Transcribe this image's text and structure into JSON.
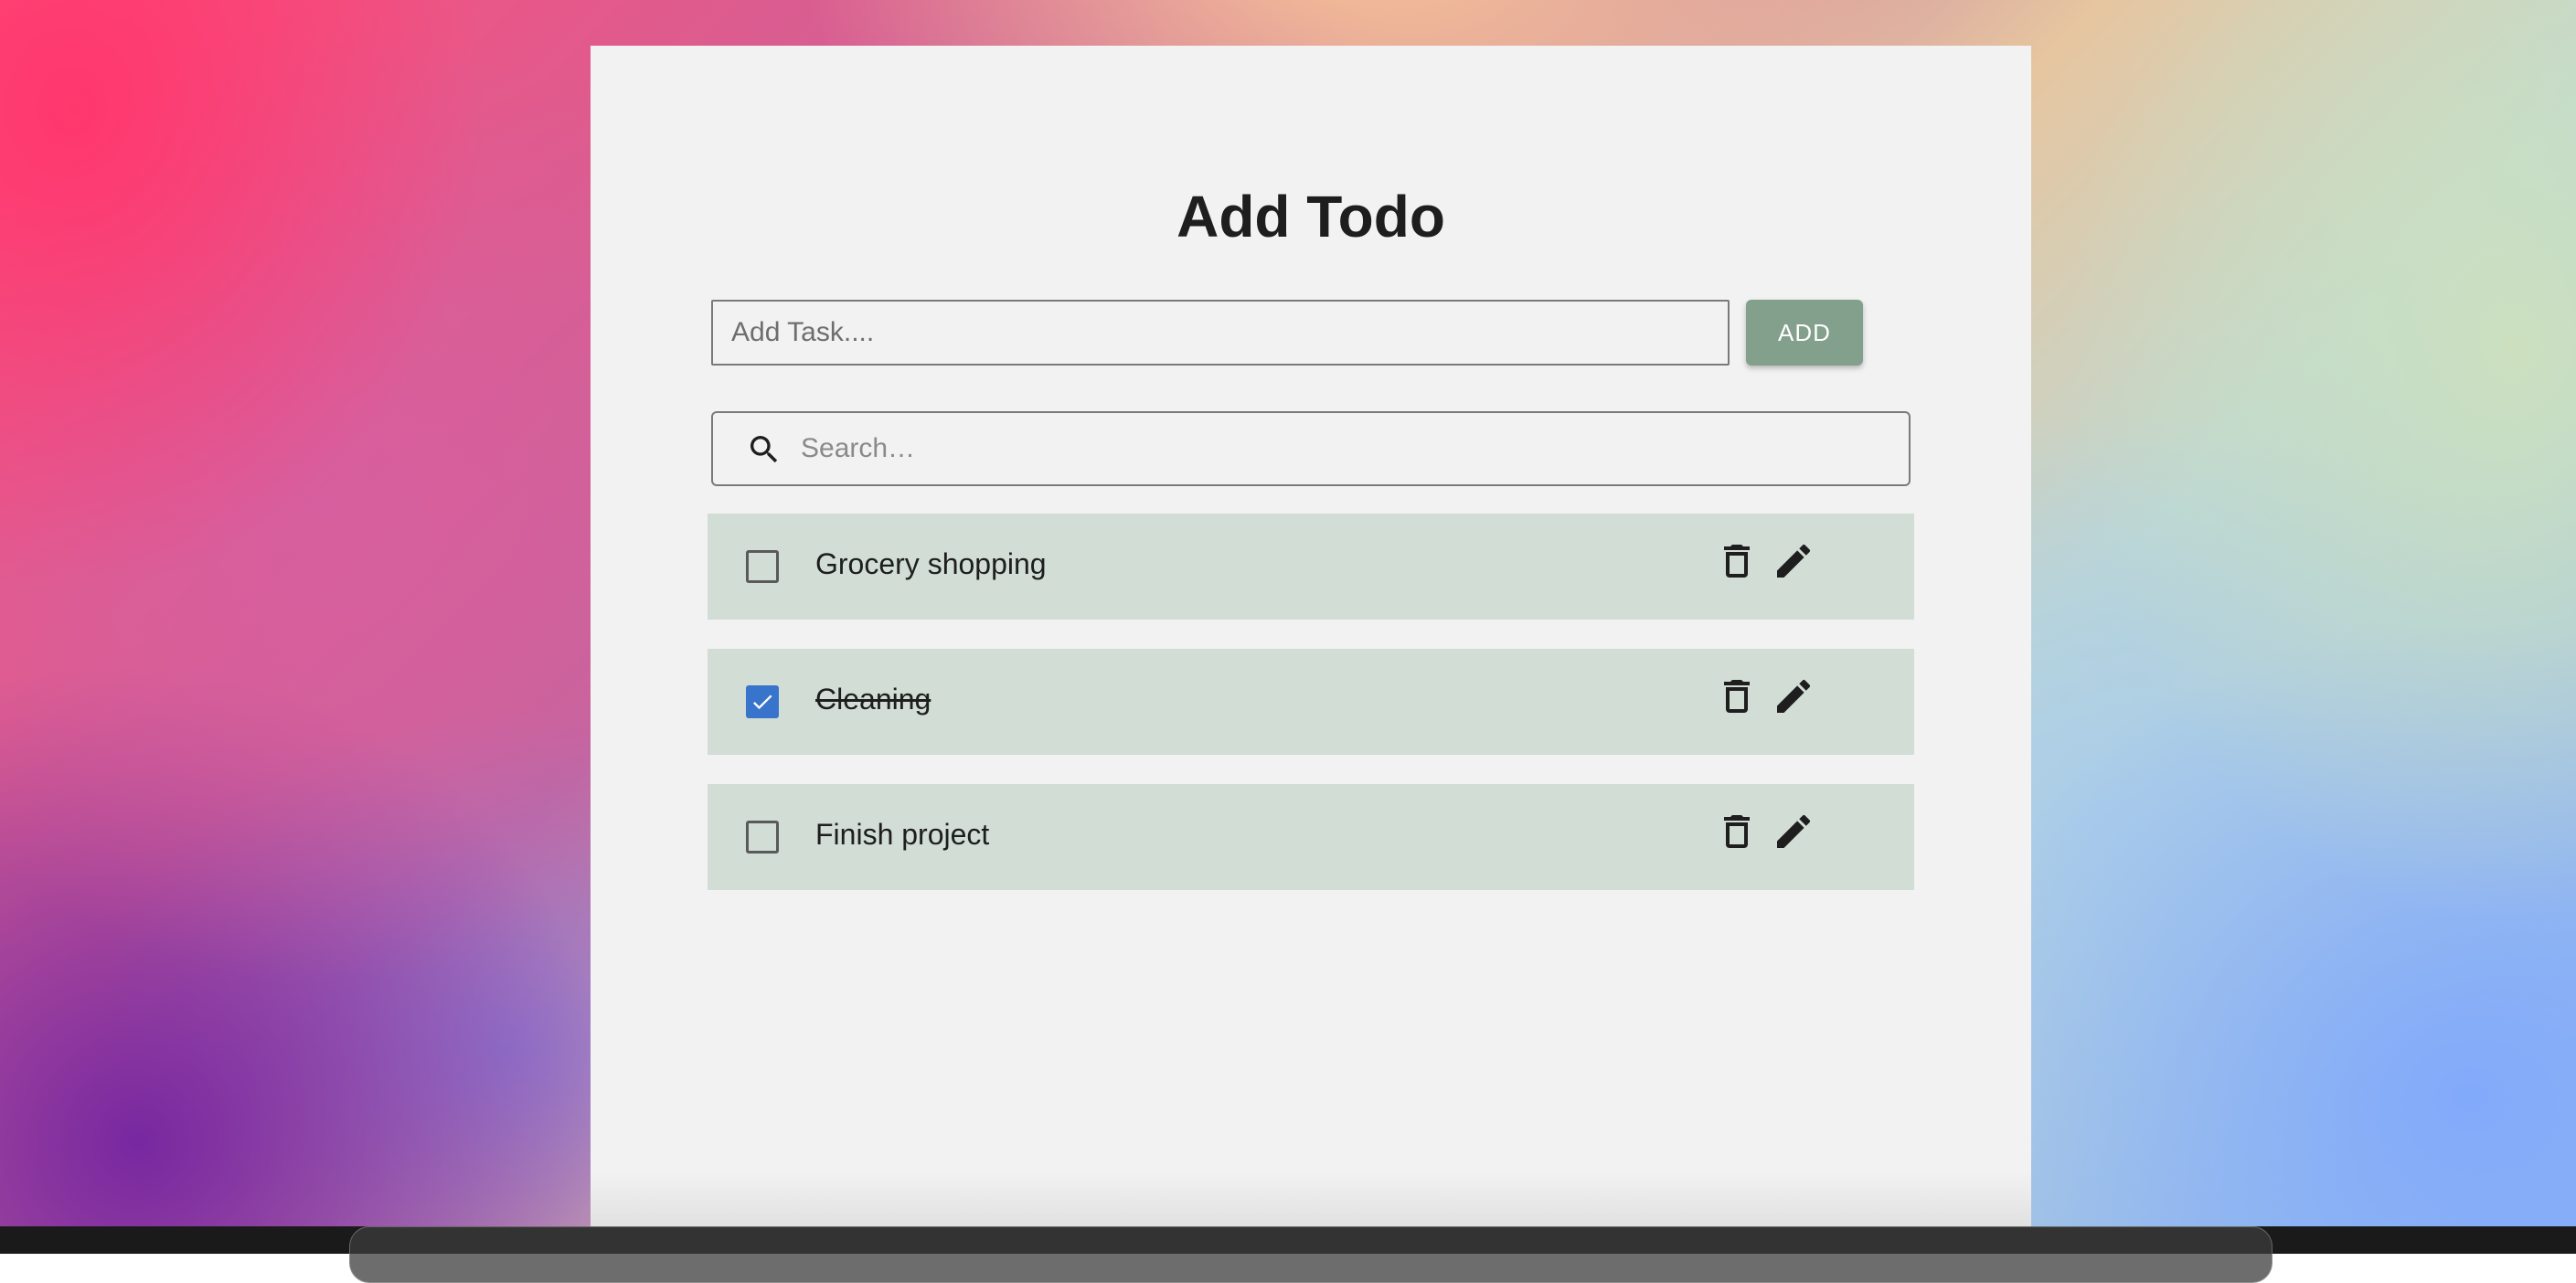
{
  "app": {
    "title": "Add Todo"
  },
  "add_form": {
    "input_placeholder": "Add Task....",
    "input_value": "",
    "add_button_label": "ADD",
    "add_button_color": "#82a08b"
  },
  "search": {
    "placeholder": "Search…",
    "value": "",
    "icon": "search-icon"
  },
  "todos": [
    {
      "text": "Grocery shopping",
      "completed": false
    },
    {
      "text": "Cleaning",
      "completed": true
    },
    {
      "text": "Finish project",
      "completed": false
    }
  ],
  "item_actions": {
    "delete_icon": "trash-icon",
    "edit_icon": "pencil-icon"
  },
  "colors": {
    "panel_background": "#f2f2f2",
    "item_background": "#d1ddd5",
    "checkbox_checked": "#3874cb",
    "text": "#1e1e1e"
  }
}
